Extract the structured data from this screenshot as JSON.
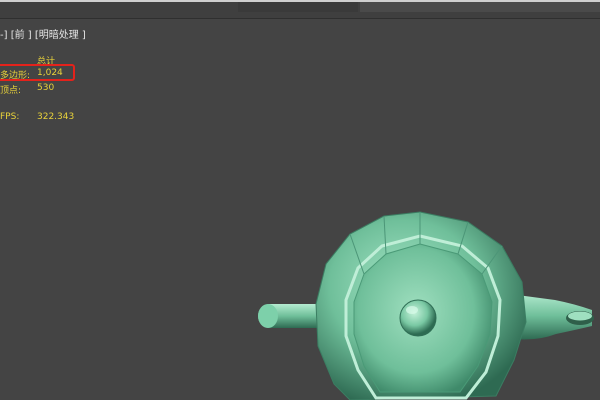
{
  "viewport": {
    "label": "-] [前 ] [明暗处理 ]"
  },
  "stats": {
    "header": "总计",
    "polygons_label": "多边形:",
    "polygons_value": "1,024",
    "vertices_label": "顶点:",
    "vertices_value": "530",
    "fps_label": "FPS:",
    "fps_value": "322.343"
  },
  "colors": {
    "background": "#444444",
    "stats_text": "#e8d23a",
    "highlight": "#e4221b",
    "object": "#6fbf9a"
  },
  "object": {
    "type": "teapot"
  }
}
